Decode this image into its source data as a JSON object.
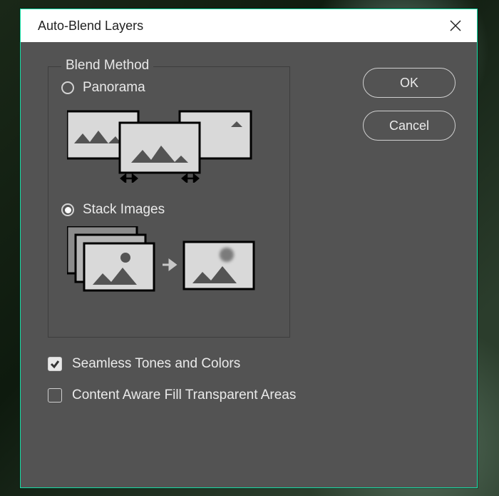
{
  "dialog": {
    "title": "Auto-Blend Layers",
    "blend_method_group": "Blend Method",
    "options": {
      "panorama": {
        "label": "Panorama",
        "selected": false
      },
      "stack": {
        "label": "Stack Images",
        "selected": true
      }
    },
    "checkboxes": {
      "seamless": {
        "label": "Seamless Tones and Colors",
        "checked": true
      },
      "content_aware": {
        "label": "Content Aware Fill Transparent Areas",
        "checked": false
      }
    }
  },
  "buttons": {
    "ok": "OK",
    "cancel": "Cancel"
  }
}
